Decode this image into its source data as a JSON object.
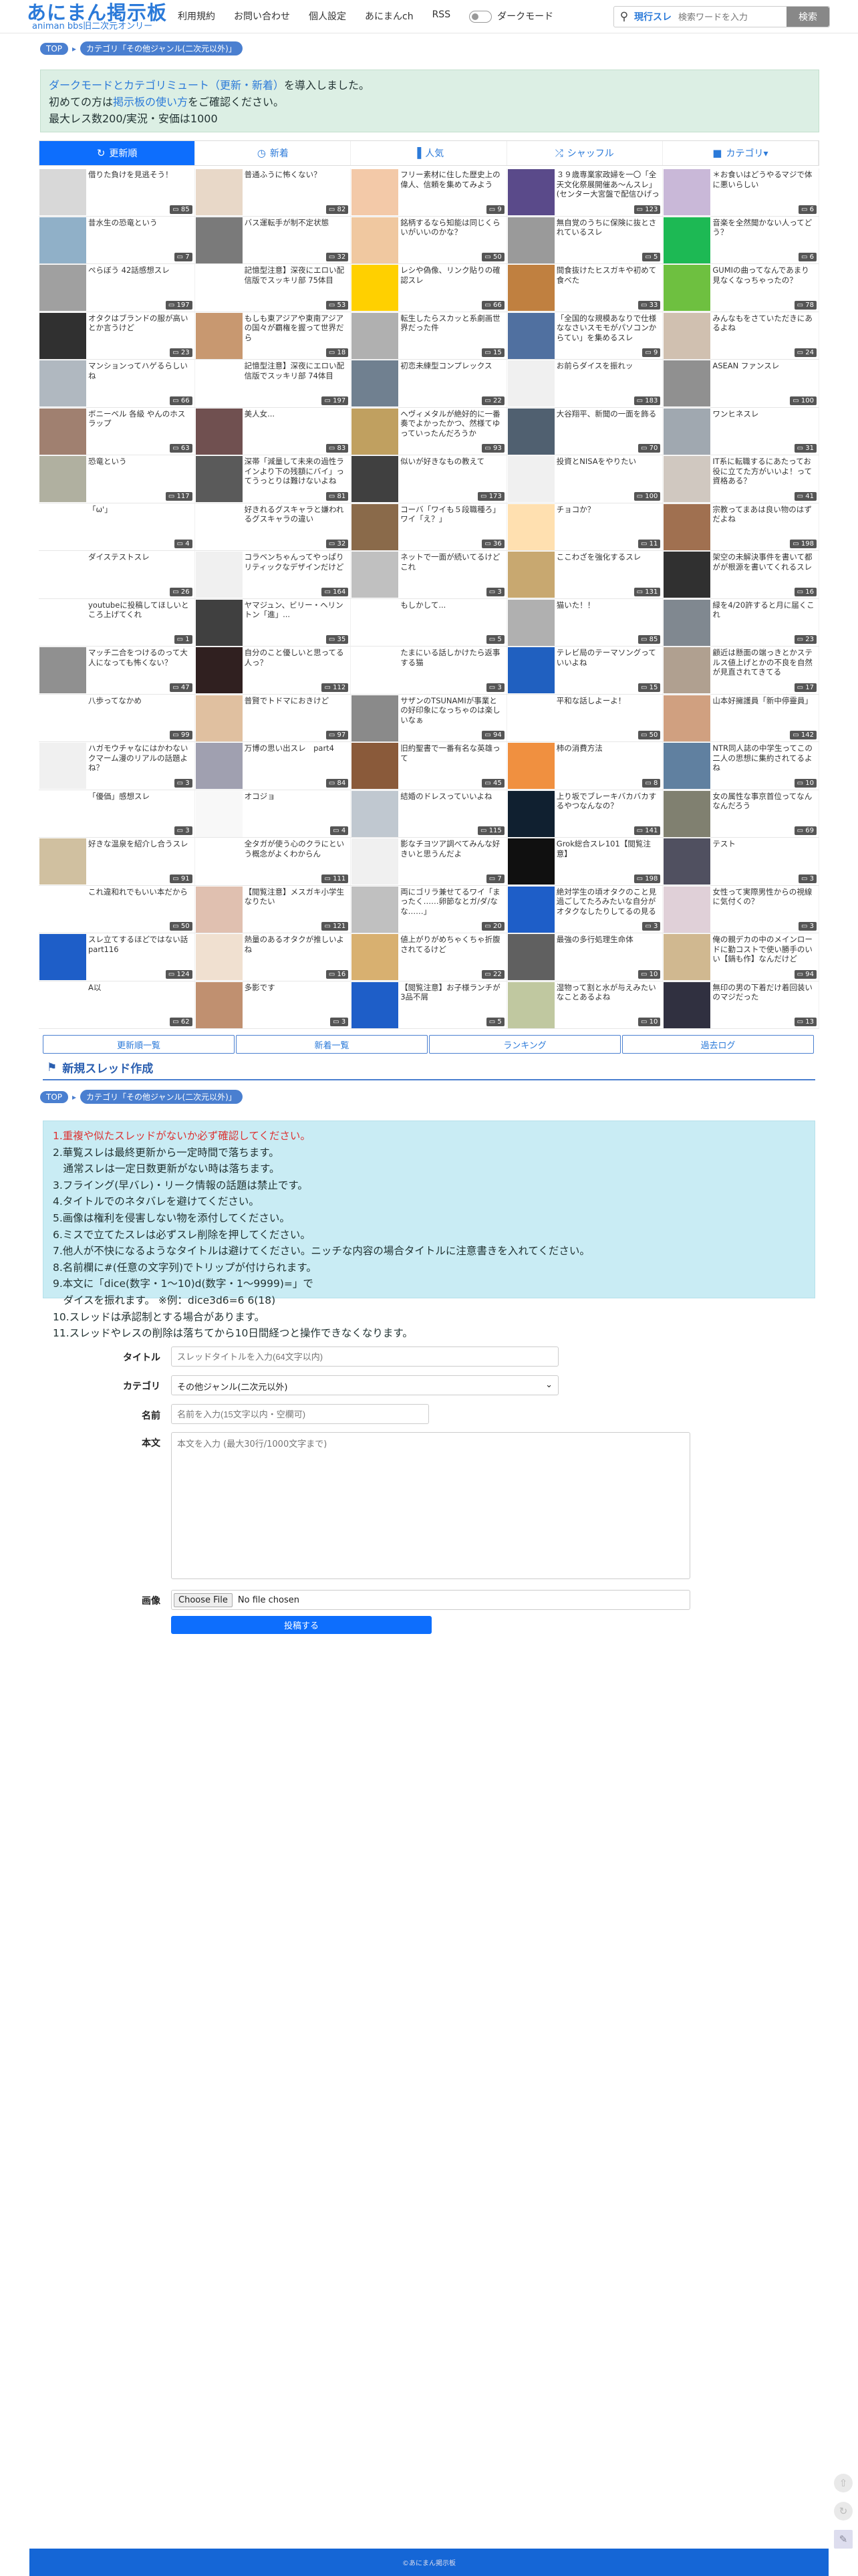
{
  "header": {
    "logo": "あにまん掲示板",
    "logo_sub": "animan bbs旧二次元オンリー",
    "nav": [
      "利用規約",
      "お問い合わせ",
      "個人設定",
      "あにまんch",
      "RSS"
    ],
    "dark_mode": "ダークモード",
    "search": {
      "scope": "現行スレ",
      "placeholder": "検索ワードを入力",
      "button": "検索"
    }
  },
  "breadcrumb": {
    "top": "TOP",
    "category": "カテゴリ「その他ジャンル(二次元以外)」"
  },
  "notice": {
    "line1_link": "ダークモードとカテゴリミュート（更新・新着）",
    "line1_rest": "を導入しました。",
    "line2_pre": "初めての方は",
    "line2_link": "掲示板の使い方",
    "line2_post": "をご確認ください。",
    "line3": "最大レス数200/実況・安価は1000"
  },
  "tabs": [
    {
      "label": "更新順",
      "icon": "↻"
    },
    {
      "label": "新着",
      "icon": "◷"
    },
    {
      "label": "人気",
      "icon": "▐"
    },
    {
      "label": "シャッフル",
      "icon": "⤮"
    },
    {
      "label": "カテゴリ▾",
      "icon": "■"
    }
  ],
  "threads": [
    {
      "title": "借りた負けを見逃そう！",
      "count": "85",
      "th": "#d8d8d8"
    },
    {
      "title": "普通ふうに怖くない？",
      "count": "82",
      "th": "#e8d8c8"
    },
    {
      "title": "フリー素材に住した歴史上の偉人、信頼を集めてみよう",
      "count": "9",
      "th": "#f3c9a8"
    },
    {
      "title": "３９歳専業家政婦を一〇「全天文化祭展開催あ～んスレ」(センター大宮盤で配信ひげっかぁ～（あっぱあ～...",
      "count": "123",
      "th": "#5a4a8a"
    },
    {
      "title": "＊お食いはどうやるマジで体に悪いらしい",
      "count": "6",
      "th": "#c9b8d8"
    },
    {
      "title": "昔水生の恐竜という",
      "count": "7",
      "th": "#90b0c8"
    },
    {
      "title": "バス運転手が制不定状態",
      "count": "32",
      "th": "#7a7a7a"
    },
    {
      "title": "銘柄するなら知能は同じくらいがいいのかな？",
      "count": "50",
      "th": "#f0c8a0"
    },
    {
      "title": "無自覚のうちに保険に抜とされているスレ",
      "count": "5",
      "th": "#9a9a9a"
    },
    {
      "title": "音楽を全然聞かない人ってどう？",
      "count": "6",
      "th": "#1db954"
    },
    {
      "title": "ぺらぼう 42話感想スレ",
      "count": "197",
      "th": "#a0a0a0"
    },
    {
      "title": "記憶型注意】深夜にエロい配信版でスッキリ部 75体目",
      "count": "53",
      "th": "#ffffff"
    },
    {
      "title": "レシや偽像、リンク貼りの確認スレ",
      "count": "66",
      "th": "#ffd000"
    },
    {
      "title": "間食抜けたヒスガキや初めて食べた",
      "count": "33",
      "th": "#c08040"
    },
    {
      "title": "GUMIの曲ってなんであまり見なくなっちゃったの？",
      "count": "78",
      "th": "#6ec040"
    },
    {
      "title": "オタクはブランドの服が高いとか言うけど",
      "count": "23",
      "th": "#303030"
    },
    {
      "title": "もしも東アジアや東南アジアの国々が覇権を握って世界だら",
      "count": "18",
      "th": "#c89870"
    },
    {
      "title": "転生したらスカッと系劇画世界だった件",
      "count": "15",
      "th": "#b0b0b0"
    },
    {
      "title": "「全国的な規模あなりで仕様ななさいスモモがパソコンからてい」を集めるスレ",
      "count": "9",
      "th": "#5070a0"
    },
    {
      "title": "みんなもをさていただきにあるよね",
      "count": "24",
      "th": "#d0c0b0"
    },
    {
      "title": "マンションってハゲるらしいね",
      "count": "66",
      "th": "#b0b8c0"
    },
    {
      "title": "記憶型注意】深夜にエロい配信版でスッキリ部 74体目",
      "count": "197",
      "th": "#ffffff"
    },
    {
      "title": "初恋未練型コンプレックス",
      "count": "22",
      "th": "#708090"
    },
    {
      "title": "お前らダイスを振れッ",
      "count": "183",
      "th": "#f0f0f0"
    },
    {
      "title": "ASEAN ファンスレ",
      "count": "100",
      "th": "#909090"
    },
    {
      "title": "ボニーベル 各級 やんのホスラップ",
      "count": "63",
      "th": "#a08070"
    },
    {
      "title": "美人女...",
      "count": "83",
      "th": "#705050"
    },
    {
      "title": "ヘヴィメタルが絶好的に一番奏でよかったかつ、然様てゆっていったんだろうか",
      "count": "93",
      "th": "#c0a060"
    },
    {
      "title": "大谷翔平、新聞の一面を飾る",
      "count": "70",
      "th": "#506070"
    },
    {
      "title": "ワンヒネスレ",
      "count": "31",
      "th": "#a0a8b0"
    },
    {
      "title": "恐竜という",
      "count": "117",
      "th": "#b0b0a0"
    },
    {
      "title": "深帯「減量して未来の過性ラインより下の残額にバイ」ってうっとりは難けないよね",
      "count": "81",
      "th": "#5a5a5a"
    },
    {
      "title": "似いが好きなもの教えて",
      "count": "173",
      "th": "#404040"
    },
    {
      "title": "投資とNISAをやりたい",
      "count": "100",
      "th": "#f0f0f0"
    },
    {
      "title": "IT系に転職するにあたってお役に立てた方がいいよ！って資格ある？",
      "count": "41",
      "th": "#d0c8c0"
    },
    {
      "title": "「ω'」",
      "count": "4",
      "th": "#ffffff"
    },
    {
      "title": "好きれるグスキャラと嫌われるグスキャラの違い",
      "count": "32",
      "th": "#ffffff"
    },
    {
      "title": "コーバ「ワイも５段職種ろ」ワイ「え？」",
      "count": "36",
      "th": "#8a6a4a"
    },
    {
      "title": "チョコか？",
      "count": "11",
      "th": "#ffe0b0"
    },
    {
      "title": "宗教ってまあは良い物のはずだよね",
      "count": "198",
      "th": "#a07050"
    },
    {
      "title": "ダイステストスレ",
      "count": "26",
      "th": "#ffffff"
    },
    {
      "title": "コラベンちゃんってやっぱりリティックなデザインだけど",
      "count": "164",
      "th": "#f0f0f0"
    },
    {
      "title": "ネットで一面が続いてるけどこれ",
      "count": "3",
      "th": "#c0c0c0"
    },
    {
      "title": "ここわざを強化するスレ",
      "count": "131",
      "th": "#c8a870"
    },
    {
      "title": "架空の未解決事件を書いて都がが根源を書いてくれるスレ",
      "count": "16",
      "th": "#303030"
    },
    {
      "title": "youtubeに投稿してほしいところ上げてくれ",
      "count": "1",
      "th": "#ffffff"
    },
    {
      "title": "ヤマジュン、ビリー・ヘリントン「進」...",
      "count": "35",
      "th": "#404040"
    },
    {
      "title": "もしかして...",
      "count": "5",
      "th": "#ffffff"
    },
    {
      "title": "猫いた！！",
      "count": "85",
      "th": "#b0b0b0"
    },
    {
      "title": "緑を4/20許すると月に届くこれ",
      "count": "23",
      "th": "#808890"
    },
    {
      "title": "マッチ二合をつけるのって大人になっても怖くない？",
      "count": "47",
      "th": "#909090"
    },
    {
      "title": "自分のこと優しいと思ってる人っ？",
      "count": "112",
      "th": "#302020"
    },
    {
      "title": "たまにいる話しかけたら返事する猫",
      "count": "3",
      "th": "#ffffff"
    },
    {
      "title": "テレビ局のテーマソングっていいよね",
      "count": "15",
      "th": "#2060c0"
    },
    {
      "title": "顧近は懸面の端っきとかステルス値上げとかの不良を自然が見直されてきてる",
      "count": "17",
      "th": "#b0a090"
    },
    {
      "title": "八歩ってなかめ",
      "count": "99",
      "th": "#ffffff"
    },
    {
      "title": "普賢でトドマにおきけど",
      "count": "97",
      "th": "#e0c0a0"
    },
    {
      "title": "サザンのTSUNAMIが事業との好印象になっちゃのは楽しいなぁ",
      "count": "94",
      "th": "#8a8a8a"
    },
    {
      "title": "平和な話しよーよ！",
      "count": "50",
      "th": "#ffffff"
    },
    {
      "title": "山本好擁護員「新中停靈員」",
      "count": "142",
      "th": "#d0a080"
    },
    {
      "title": "ハガモウチャなにはかわないクマーム漫のリアルの話題よね？",
      "count": "3",
      "th": "#f0f0f0"
    },
    {
      "title": "万博の思い出スレ　part4",
      "count": "84",
      "th": "#a0a0b0"
    },
    {
      "title": "旧約聖書で一番有名な英雄って",
      "count": "45",
      "th": "#8a5a3a"
    },
    {
      "title": "柿の消費方法",
      "count": "8",
      "th": "#f09040"
    },
    {
      "title": "NTR同人誌の中学生ってこの二人の思想に集約されてるよね",
      "count": "10",
      "th": "#6080a0"
    },
    {
      "title": "「優価」感想スレ",
      "count": "3",
      "th": "#ffffff"
    },
    {
      "title": "オコジョ",
      "count": "4",
      "th": "#f8f8f8"
    },
    {
      "title": "結婚のドレスっていいよね",
      "count": "115",
      "th": "#c0c8d0"
    },
    {
      "title": "上り坂でブレーキバカバカするやつなんなの？",
      "count": "141",
      "th": "#102030"
    },
    {
      "title": "女の属性な事京首位ってなんなんだろう",
      "count": "69",
      "th": "#808070"
    },
    {
      "title": "好きな温泉を紹介し合うスレ",
      "count": "91",
      "th": "#d0c0a0"
    },
    {
      "title": "全タガが使う心のクラにという概念がよくわからん",
      "count": "111",
      "th": "#ffffff"
    },
    {
      "title": "影なチヨツア調べてみんな好きいと思うんだよ",
      "count": "7",
      "th": "#f0f0f0"
    },
    {
      "title": "Grok総合スレ101【閲覧注意】",
      "count": "198",
      "th": "#101010"
    },
    {
      "title": "テスト",
      "count": "3",
      "th": "#505060"
    },
    {
      "title": "これ違和れでもいい本だから",
      "count": "50",
      "th": "#ffffff"
    },
    {
      "title": "【閲覧注意】メスガキ小学生なりたい",
      "count": "121",
      "th": "#e0c0b0"
    },
    {
      "title": "両にゴリラ兼せてるワイ「まったく……卵節なとガ/ダ/なな……」",
      "count": "20",
      "th": "#c0c0c0"
    },
    {
      "title": "絶対学生の頃オタクのこと見過ごしてたろみたいな自分がオタクなしたりしてるの見るとムカつく",
      "count": "3",
      "th": "#1e5ec8"
    },
    {
      "title": "女性って実際男性からの視線に気付くの？",
      "count": "3",
      "th": "#e0d0d8"
    },
    {
      "title": "スレ立てするほどではない話part116",
      "count": "124",
      "th": "#1e5ec8"
    },
    {
      "title": "熱量のあるオタクが推しいよね",
      "count": "16",
      "th": "#f0e0d0"
    },
    {
      "title": "値上がりがめちゃくちゃ折腹されてるけど",
      "count": "22",
      "th": "#d8b070"
    },
    {
      "title": "最強の多行処理生命体",
      "count": "10",
      "th": "#606060"
    },
    {
      "title": "俺の親デカの中のメインロードに勤コストで使い勝手のいい【鍋も作】なんだけど",
      "count": "94",
      "th": "#d0b890"
    },
    {
      "title": "A以",
      "count": "62",
      "th": "#ffffff"
    },
    {
      "title": "多影です",
      "count": "3",
      "th": "#c09070"
    },
    {
      "title": "【閲覧注意】お子様ランチが3品不屑",
      "count": "5",
      "th": "#1e5ec8"
    },
    {
      "title": "湿物って割と水が与えみたいなことあるよね",
      "count": "10",
      "th": "#c0c8a0"
    },
    {
      "title": "無印の男の下着だけ着回装いのマジだった",
      "count": "13",
      "th": "#303040"
    }
  ],
  "bottom_buttons": [
    "更新順一覧",
    "新着一覧",
    "ランキング",
    "過去ログ"
  ],
  "new_thread": {
    "title": "新規スレッド作成",
    "rules": [
      {
        "text": "1.重複や似たスレッドがないか必ず確認してください。",
        "cls": "red"
      },
      {
        "text": "2.華覧スレは最終更新から一定時間で落ちます。",
        "cls": ""
      },
      {
        "text": "　通常スレは一定日数更新がない時は落ちます。",
        "cls": ""
      },
      {
        "text": "3.フライング(早バレ)・リーク情報の話題は禁止です。",
        "cls": ""
      },
      {
        "text": "4.タイトルでのネタバレを避けてください。",
        "cls": ""
      },
      {
        "text": "5.画像は権利を侵害しない物を添付してください。",
        "cls": ""
      },
      {
        "text": "6.ミスで立てたスレは必ずスレ削除を押してください。",
        "cls": ""
      },
      {
        "text": "7.他人が不快になるようなタイトルは避けてください。ニッチな内容の場合タイトルに注意書きを入れてください。",
        "cls": ""
      },
      {
        "text": "8.名前欄に#(任意の文字列)でトリップが付けられます。",
        "cls": ""
      },
      {
        "text": "9.本文に「dice(数字・1〜10)d(数字・1〜9999)=」で",
        "cls": ""
      },
      {
        "text": "　ダイスを振れます。 ※例：dice3d6=6 6(18)",
        "cls": ""
      },
      {
        "text": "10.スレッドは承認制とする場合があります。",
        "cls": ""
      },
      {
        "text": "11.スレッドやレスの削除は落ちてから10日間経つと操作できなくなります。",
        "cls": ""
      }
    ],
    "labels": {
      "title": "タイトル",
      "category": "カテゴリ",
      "name": "名前",
      "body": "本文",
      "image": "画像"
    },
    "placeholders": {
      "title": "スレッドタイトルを入力(64文字以内)",
      "name": "名前を入力(15文字以内・空欄可)",
      "body": "本文を入力 (最大30行/1000文字まで)"
    },
    "category_value": "その他ジャンル(二次元以外)",
    "file_button": "Choose File",
    "file_status": "No file chosen",
    "submit": "投稿する"
  },
  "footer": "©あにまん掲示板"
}
